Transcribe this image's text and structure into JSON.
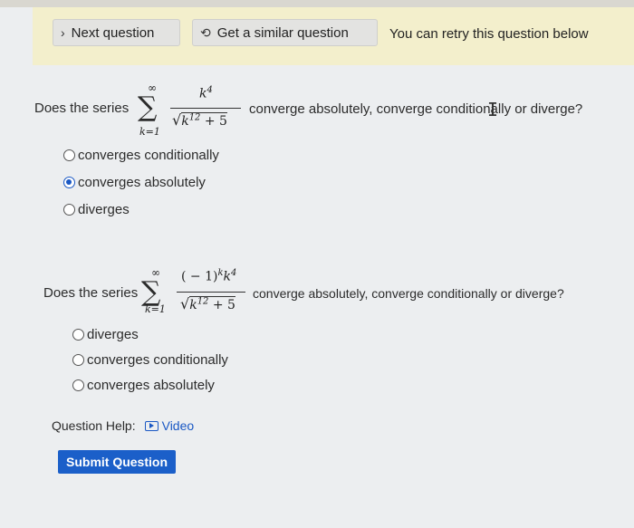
{
  "banner": {
    "next_label": "Next question",
    "similar_label": "Get a similar question",
    "retry_text": "You can retry this question below"
  },
  "q1": {
    "prefix": "Does the series",
    "sum_upper": "∞",
    "sum_lower": "k=1",
    "numerator": "k",
    "numerator_exp": "4",
    "denominator_base": "k",
    "denominator_exp": "12",
    "denominator_tail": "+ 5",
    "suffix": "converge absolutely, converge conditionally or diverge?",
    "options": [
      "converges conditionally",
      "converges absolutely",
      "diverges"
    ],
    "selected_index": 1
  },
  "q2": {
    "prefix": "Does the series",
    "sum_upper": "∞",
    "sum_lower": "k=1",
    "numerator_lead": "( − 1)",
    "numerator_exp1": "k",
    "numerator_k": "k",
    "numerator_exp2": "4",
    "denominator_base": "k",
    "denominator_exp": "12",
    "denominator_tail": "+ 5",
    "suffix": "converge absolutely, converge conditionally or diverge?",
    "options": [
      "diverges",
      "converges conditionally",
      "converges absolutely"
    ],
    "selected_index": -1
  },
  "help": {
    "label": "Question Help:",
    "video_label": "Video"
  },
  "submit_label": "Submit Question"
}
